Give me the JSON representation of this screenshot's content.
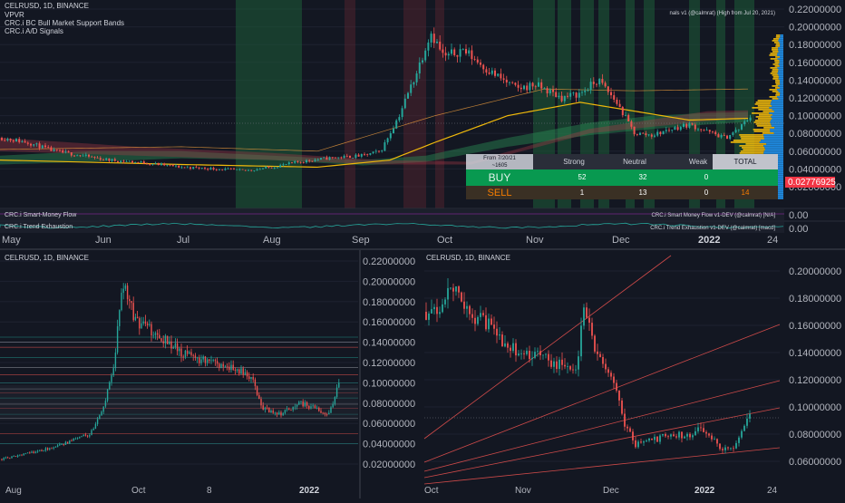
{
  "colors": {
    "bg": "#131722",
    "grid": "#1e2230",
    "up": "#26a69a",
    "down": "#ef5350",
    "gold": "#f0b90b",
    "blue": "#2196f3",
    "priceTag": "#f23645",
    "greenBand": "#1e5c38",
    "redBand": "#5c2630"
  },
  "main": {
    "title": "CELRUSD, 1D, BINANCE",
    "indicators": [
      "VPVR",
      "CRC.i BC Bull Market Support Bands",
      "CRC.i A/D Signals"
    ],
    "topRightNote": "nals v1 (@calmrat) (High from Jul 20, 2021)",
    "priceAxis": [
      "0.22000000",
      "0.20000000",
      "0.18000000",
      "0.16000000",
      "0.14000000",
      "0.12000000",
      "0.10000000",
      "0.08000000",
      "0.06000000",
      "0.04000000",
      "0.02000000"
    ],
    "priceTag": "0.02776925",
    "timeAxis": [
      "May",
      "Jun",
      "Jul",
      "Aug",
      "Sep",
      "Oct",
      "Nov",
      "Dec",
      "2022",
      "24"
    ],
    "table": {
      "fromLabel": "From 7/20/21",
      "fromSub": "~1605",
      "headers": [
        "Strong",
        "Neutral",
        "Weak",
        "TOTAL"
      ],
      "rows": [
        {
          "label": "BUY",
          "values": [
            "52",
            "32",
            "0"
          ]
        },
        {
          "label": "SELL",
          "values": [
            "1",
            "13",
            "0",
            "14"
          ]
        }
      ]
    },
    "pane1": {
      "title": "CRC.i Smart-Money Flow",
      "right": "CRC.i Smart Money Flow v1-DEV (@calmrat) [N/A]",
      "axis": "0.00"
    },
    "pane2": {
      "title": "CRC.i Trend Exhaustion",
      "right": "CRC.i Trend Exhaustion v1-DEV (@calmrat) [macd]",
      "axis": "0.00"
    }
  },
  "bottomLeft": {
    "title": "CELRUSD, 1D, BINANCE",
    "priceAxis": [
      "0.22000000",
      "0.20000000",
      "0.18000000",
      "0.16000000",
      "0.14000000",
      "0.12000000",
      "0.10000000",
      "0.08000000",
      "0.06000000",
      "0.04000000",
      "0.02000000"
    ],
    "timeAxis": [
      "Aug",
      "Oct",
      "8",
      "2022"
    ]
  },
  "bottomRight": {
    "title": "CELRUSD, 1D, BINANCE",
    "priceAxis": [
      "0.20000000",
      "0.18000000",
      "0.16000000",
      "0.14000000",
      "0.12000000",
      "0.10000000",
      "0.08000000",
      "0.06000000"
    ],
    "timeAxis": [
      "Oct",
      "Nov",
      "Dec",
      "2022",
      "24"
    ]
  },
  "chart_data": [
    {
      "type": "candlestick",
      "title": "CELRUSD, 1D, BINANCE",
      "x_ticks": [
        "May",
        "Jun",
        "Jul",
        "Aug",
        "Sep",
        "Oct",
        "Nov",
        "Dec",
        "2022",
        "24"
      ],
      "ylim": [
        0.02,
        0.22
      ],
      "series": [
        {
          "name": "close",
          "x": [
            "May",
            "Jun",
            "Jul",
            "Aug",
            "Sep",
            "Oct",
            "Nov",
            "Dec",
            "2022"
          ],
          "values": [
            0.065,
            0.05,
            0.038,
            0.045,
            0.06,
            0.2,
            0.12,
            0.085,
            0.1
          ]
        }
      ],
      "last_price": 0.02776925
    },
    {
      "type": "candlestick",
      "title": "CELRUSD, 1D, BINANCE",
      "x_ticks": [
        "Aug",
        "Oct",
        "8",
        "2022"
      ],
      "ylim": [
        0.02,
        0.22
      ],
      "horizontal_levels": [
        0.145,
        0.14,
        0.135,
        0.125,
        0.115,
        0.108,
        0.1,
        0.094,
        0.09,
        0.085,
        0.079,
        0.075,
        0.069,
        0.065,
        0.05,
        0.04
      ],
      "series": [
        {
          "name": "close",
          "x": [
            "Aug",
            "Oct",
            "8",
            "2022"
          ],
          "values": [
            0.03,
            0.17,
            0.12,
            0.1
          ]
        }
      ]
    },
    {
      "type": "candlestick",
      "title": "CELRUSD, 1D, BINANCE",
      "x_ticks": [
        "Oct",
        "Nov",
        "Dec",
        "2022",
        "24"
      ],
      "ylim": [
        0.06,
        0.2
      ],
      "horizontal_levels": [
        0.102
      ],
      "series": [
        {
          "name": "close",
          "x": [
            "Oct",
            "Nov",
            "Dec",
            "2022"
          ],
          "values": [
            0.17,
            0.14,
            0.08,
            0.1
          ]
        }
      ]
    }
  ]
}
